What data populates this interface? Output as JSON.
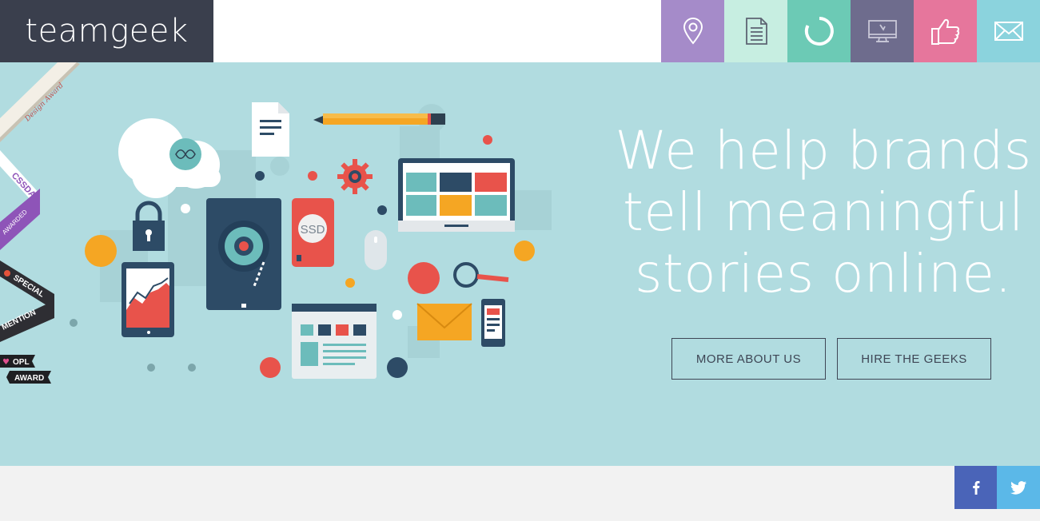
{
  "brand": {
    "name": "teamgeek"
  },
  "nav": {
    "items": [
      {
        "name": "location",
        "color": "#a58bc9"
      },
      {
        "name": "document",
        "color": "#c7eee1"
      },
      {
        "name": "loader",
        "color": "#6ccab5"
      },
      {
        "name": "monitor",
        "color": "#6e6c8d"
      },
      {
        "name": "thumbs-up",
        "color": "#e6769c"
      },
      {
        "name": "mail",
        "color": "#8bd3dd"
      }
    ]
  },
  "hero": {
    "headline": [
      "We help brands",
      "tell meaningful",
      "stories online."
    ],
    "buttons": {
      "about": "MORE ABOUT US",
      "hire": "HIRE THE GEEKS"
    },
    "illustration_text": {
      "ssd": "SSD"
    },
    "background": "#b1dce0"
  },
  "awards": {
    "design_award": "Design Award",
    "cssda": "CSSDA",
    "awarded": "AWARDED",
    "special": "SPECIAL",
    "mention": "MENTION",
    "opl": "OPL",
    "award": "AWARD"
  },
  "social": {
    "facebook": {
      "label": "f",
      "color": "#4a64b8"
    },
    "twitter": {
      "color": "#5bb8e8"
    }
  }
}
